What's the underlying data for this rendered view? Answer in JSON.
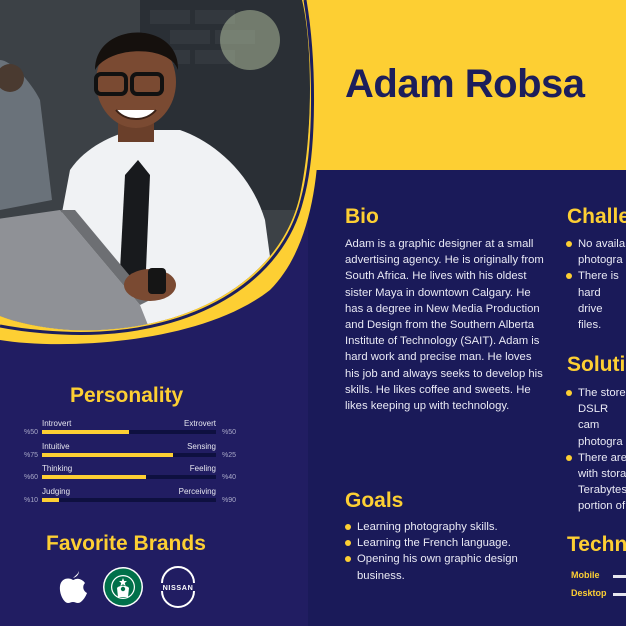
{
  "name": "Adam Robsa",
  "colors": {
    "accent": "#fdcf33",
    "navy": "#1c1f5e",
    "text": "#e9e9f4"
  },
  "bio": {
    "title": "Bio",
    "text": "Adam is a graphic designer at a small advertising agency. He is originally from South Africa. He lives with his oldest sister Maya in downtown Calgary. He has a degree in New Media Production and Design from the Southern Alberta Institute of Technology (SAIT). Adam is hard work and precise man. He loves his job and always seeks to develop his skills. He likes coffee and sweets. He likes keeping up with technology."
  },
  "goals": {
    "title": "Goals",
    "items": [
      "Learning photography skills.",
      "Learning the French language.",
      "Opening his own graphic design business."
    ]
  },
  "challenges": {
    "title": "Challe",
    "items": [
      "No availa photogra",
      "There is hard drive files."
    ]
  },
  "solutions": {
    "title": "Soluti",
    "items": [
      "The store DSLR cam photogra",
      "There are with stora Terabytes portion of"
    ]
  },
  "technology": {
    "title": "Techn",
    "rows": [
      {
        "label": "Mobile"
      },
      {
        "label": "Desktop"
      }
    ]
  },
  "personality": {
    "title": "Personality",
    "traits": [
      {
        "left": "Introvert",
        "right": "Extrovert",
        "left_pct": "%50",
        "right_pct": "%50",
        "value": 0.5
      },
      {
        "left": "Intuitive",
        "right": "Sensing",
        "left_pct": "%75",
        "right_pct": "%25",
        "value": 0.75
      },
      {
        "left": "Thinking",
        "right": "Feeling",
        "left_pct": "%60",
        "right_pct": "%40",
        "value": 0.6
      },
      {
        "left": "Judging",
        "right": "Perceiving",
        "left_pct": "%10",
        "right_pct": "%90",
        "value": 0.1
      }
    ]
  },
  "brands": {
    "title": "Favorite Brands",
    "items": [
      {
        "name": "apple-logo",
        "icon": "apple-icon"
      },
      {
        "name": "starbucks-logo",
        "icon": "starbucks-icon"
      },
      {
        "name": "nissan-logo",
        "icon": "nissan-icon",
        "text": "NISSAN"
      }
    ]
  }
}
